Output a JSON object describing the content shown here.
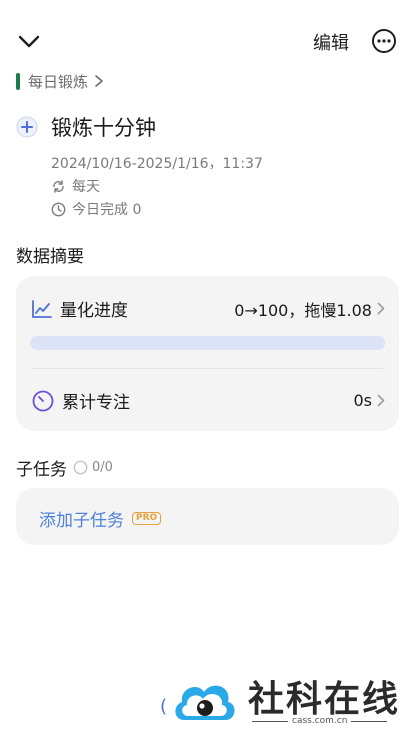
{
  "header": {
    "edit_label": "编辑",
    "back_icon": "chevron-down-icon",
    "more_icon": "more-horizontal-icon"
  },
  "breadcrumb": {
    "label": "每日锻炼",
    "accent_color": "#1f7a4d"
  },
  "task": {
    "title": "锻炼十分钟",
    "date_range": "2024/10/16-2025/1/16，11:37",
    "repeat": "每天",
    "today_done": "今日完成 0"
  },
  "summary": {
    "section_title": "数据摘要",
    "progress": {
      "label": "量化进度",
      "value": "0→100，拖慢1.08",
      "fill_percent": 0
    },
    "focus": {
      "label": "累计专注",
      "value": "0s"
    }
  },
  "subtasks": {
    "title": "子任务",
    "count": "0/0",
    "add_label": "添加子任务",
    "pro_badge": "PRO"
  },
  "watermark": {
    "brand": "社科在线",
    "domain": "cass.com.cn"
  },
  "colors": {
    "accent": "#4f6fd8",
    "link": "#4f7fd6",
    "pro": "#e6a23c",
    "card_bg": "#f4f4f5"
  }
}
